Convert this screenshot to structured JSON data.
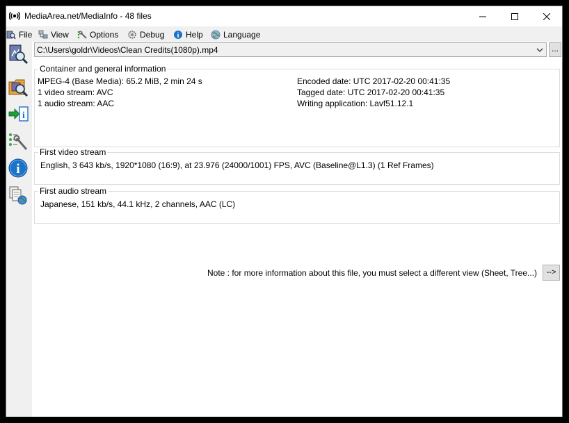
{
  "window": {
    "title": "MediaArea.net/MediaInfo - 48 files"
  },
  "menu": {
    "items": [
      {
        "label": "File",
        "icon": "file-icon"
      },
      {
        "label": "View",
        "icon": "view-icon"
      },
      {
        "label": "Options",
        "icon": "options-icon"
      },
      {
        "label": "Debug",
        "icon": "debug-icon"
      },
      {
        "label": "Help",
        "icon": "help-icon"
      },
      {
        "label": "Language",
        "icon": "globe-icon"
      }
    ]
  },
  "sidebar": {
    "buttons": [
      {
        "icon": "open-file-icon"
      },
      {
        "icon": "open-folder-icon"
      },
      {
        "icon": "export-icon"
      },
      {
        "icon": "preferences-icon"
      },
      {
        "icon": "about-icon"
      },
      {
        "icon": "knowledge-base-icon"
      }
    ]
  },
  "file_selector": {
    "value": "C:\\Users\\goldr\\Videos\\Clean Credits(1080p).mp4",
    "browse_label": "..."
  },
  "general": {
    "heading": "Container and general information",
    "left": [
      "MPEG-4 (Base Media): 65.2 MiB, 2 min 24 s",
      "1 video stream: AVC",
      "1 audio stream: AAC"
    ],
    "right": [
      "Encoded date: UTC 2017-02-20 00:41:35",
      "Tagged date: UTC 2017-02-20 00:41:35",
      "Writing application: Lavf51.12.1"
    ]
  },
  "video": {
    "heading": "First video stream",
    "text": "English, 3 643 kb/s, 1920*1080 (16:9), at 23.976 (24000/1001) FPS, AVC (Baseline@L1.3) (1 Ref Frames)"
  },
  "audio": {
    "heading": "First audio stream",
    "text": "Japanese, 151 kb/s, 44.1 kHz, 2 channels, AAC (LC)"
  },
  "note": {
    "text": "Note : for more information about this file, you must select a different view (Sheet, Tree...)",
    "button_label": "-->"
  },
  "colors": {
    "info_blue": "#1a73c9",
    "export_green": "#1e9e3a"
  }
}
